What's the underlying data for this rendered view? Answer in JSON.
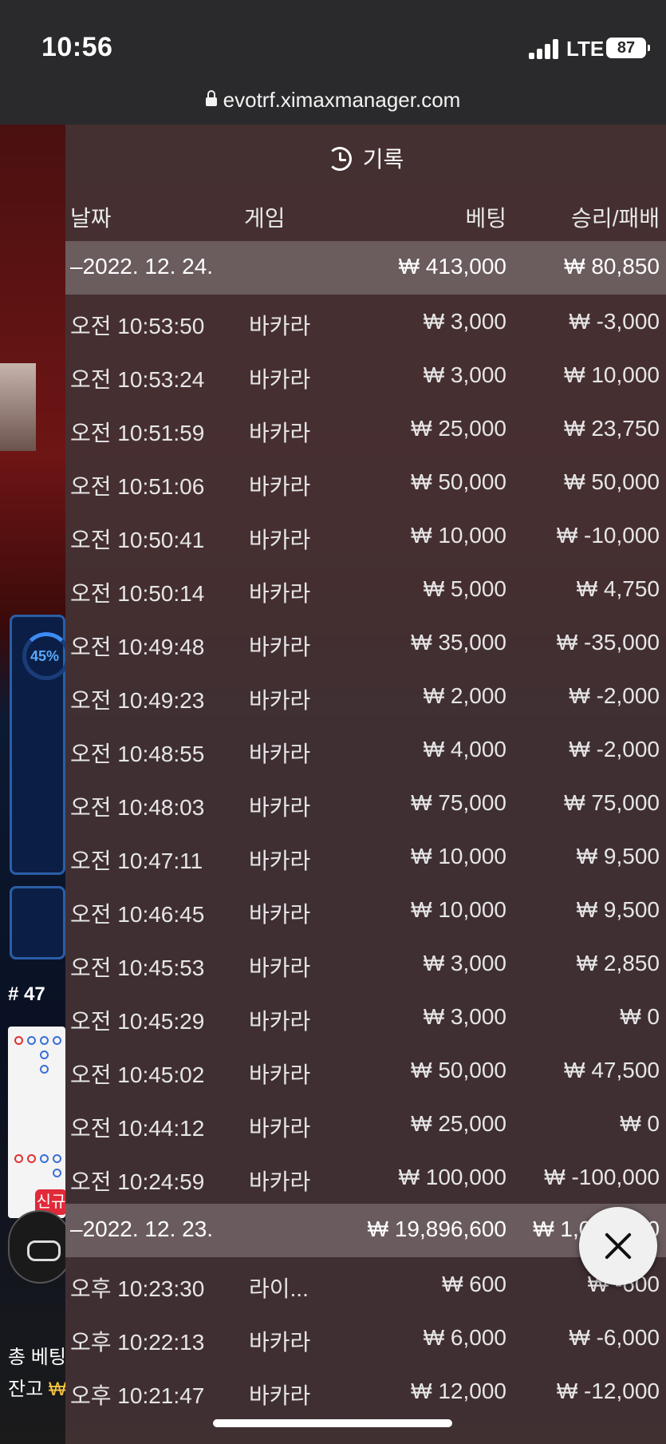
{
  "status": {
    "time": "10:56",
    "network": "LTE",
    "battery": "87"
  },
  "browser": {
    "url": "evotrf.ximaxmanager.com"
  },
  "background": {
    "progress_percent": "45%",
    "round_number": "# 47",
    "new_badge": "신규",
    "total_bet_label": "총 베팅",
    "balance_label": "잔고",
    "balance_currency": "₩"
  },
  "history": {
    "title": "기록",
    "columns": {
      "date": "날짜",
      "game": "게임",
      "bet": "베팅",
      "win_loss": "승리/패배"
    },
    "groups": [
      {
        "date": "–2022. 12. 24.",
        "total_bet": "₩ 413,000",
        "total_win": "₩ 80,850",
        "rows": [
          {
            "time": "오전 10:53:50",
            "game": "바카라",
            "bet": "₩ 3,000",
            "result": "₩ -3,000"
          },
          {
            "time": "오전 10:53:24",
            "game": "바카라",
            "bet": "₩ 3,000",
            "result": "₩ 10,000"
          },
          {
            "time": "오전 10:51:59",
            "game": "바카라",
            "bet": "₩ 25,000",
            "result": "₩ 23,750"
          },
          {
            "time": "오전 10:51:06",
            "game": "바카라",
            "bet": "₩ 50,000",
            "result": "₩ 50,000"
          },
          {
            "time": "오전 10:50:41",
            "game": "바카라",
            "bet": "₩ 10,000",
            "result": "₩ -10,000"
          },
          {
            "time": "오전 10:50:14",
            "game": "바카라",
            "bet": "₩ 5,000",
            "result": "₩ 4,750"
          },
          {
            "time": "오전 10:49:48",
            "game": "바카라",
            "bet": "₩ 35,000",
            "result": "₩ -35,000"
          },
          {
            "time": "오전 10:49:23",
            "game": "바카라",
            "bet": "₩ 2,000",
            "result": "₩ -2,000"
          },
          {
            "time": "오전 10:48:55",
            "game": "바카라",
            "bet": "₩ 4,000",
            "result": "₩ -2,000"
          },
          {
            "time": "오전 10:48:03",
            "game": "바카라",
            "bet": "₩ 75,000",
            "result": "₩ 75,000"
          },
          {
            "time": "오전 10:47:11",
            "game": "바카라",
            "bet": "₩ 10,000",
            "result": "₩ 9,500"
          },
          {
            "time": "오전 10:46:45",
            "game": "바카라",
            "bet": "₩ 10,000",
            "result": "₩ 9,500"
          },
          {
            "time": "오전 10:45:53",
            "game": "바카라",
            "bet": "₩ 3,000",
            "result": "₩ 2,850"
          },
          {
            "time": "오전 10:45:29",
            "game": "바카라",
            "bet": "₩ 3,000",
            "result": "₩ 0"
          },
          {
            "time": "오전 10:45:02",
            "game": "바카라",
            "bet": "₩ 50,000",
            "result": "₩ 47,500"
          },
          {
            "time": "오전 10:44:12",
            "game": "바카라",
            "bet": "₩ 25,000",
            "result": "₩ 0"
          },
          {
            "time": "오전 10:24:59",
            "game": "바카라",
            "bet": "₩ 100,000",
            "result": "₩ -100,000"
          }
        ]
      },
      {
        "date": "–2022. 12. 23.",
        "total_bet": "₩ 19,896,600",
        "total_win": "₩ 1,000,000",
        "rows": [
          {
            "time": "오후 10:23:30",
            "game": "라이...",
            "bet": "₩ 600",
            "result": "₩ -600"
          },
          {
            "time": "오후 10:22:13",
            "game": "바카라",
            "bet": "₩ 6,000",
            "result": "₩ -6,000"
          },
          {
            "time": "오후 10:21:47",
            "game": "바카라",
            "bet": "₩ 12,000",
            "result": "₩ -12,000"
          }
        ]
      }
    ]
  },
  "icons": {
    "history": "history-icon",
    "close": "close-icon",
    "lock": "lock-icon"
  }
}
